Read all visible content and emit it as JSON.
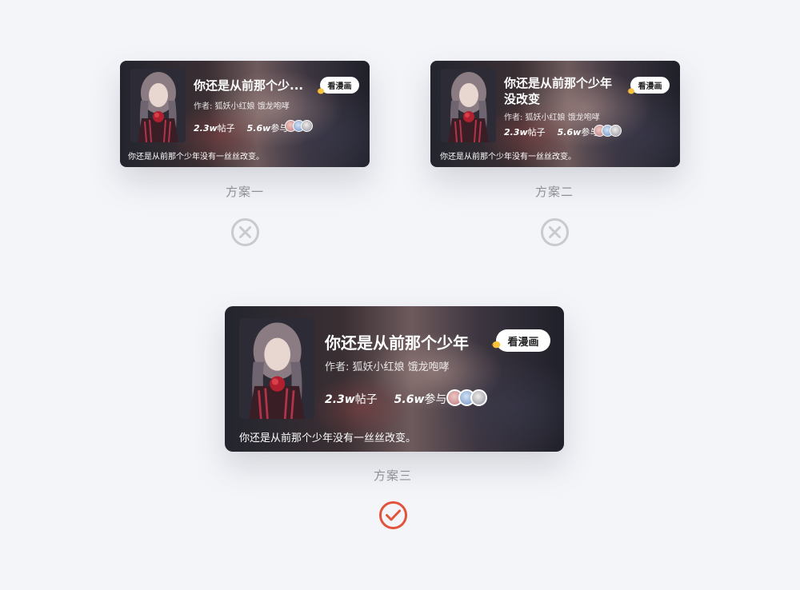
{
  "options": [
    {
      "label": "方案一",
      "result": "reject",
      "card": {
        "title": "你还是从前那个少...",
        "author": "作者: 狐妖小红娘   饿龙咆哮",
        "button": "看漫画",
        "posts_num": "2.3w",
        "posts_unit": "帖子",
        "join_num": "5.6w",
        "join_unit": "参与",
        "desc": "你还是从前那个少年没有一丝丝改变。"
      }
    },
    {
      "label": "方案二",
      "result": "reject",
      "card": {
        "title_line1": "你还是从前那个少年",
        "title_line2": "没改变",
        "author": "作者: 狐妖小红娘   饿龙咆哮",
        "button": "看漫画",
        "posts_num": "2.3w",
        "posts_unit": "帖子",
        "join_num": "5.6w",
        "join_unit": "参与",
        "desc": "你还是从前那个少年没有一丝丝改变。"
      }
    },
    {
      "label": "方案三",
      "result": "accept",
      "card": {
        "title": "你还是从前那个少年",
        "author": "作者: 狐妖小红娘   饿龙咆哮",
        "button": "看漫画",
        "posts_num": "2.3w",
        "posts_unit": "帖子",
        "join_num": "5.6w",
        "join_unit": "参与",
        "desc": "你还是从前那个少年没有一丝丝改变。"
      }
    }
  ],
  "icons": {
    "reject": "close-circle-icon",
    "accept": "check-circle-icon"
  },
  "colors": {
    "reject": "#c9cacf",
    "accept": "#e2533c",
    "background": "#f4f5f9",
    "label": "#8e9096"
  }
}
